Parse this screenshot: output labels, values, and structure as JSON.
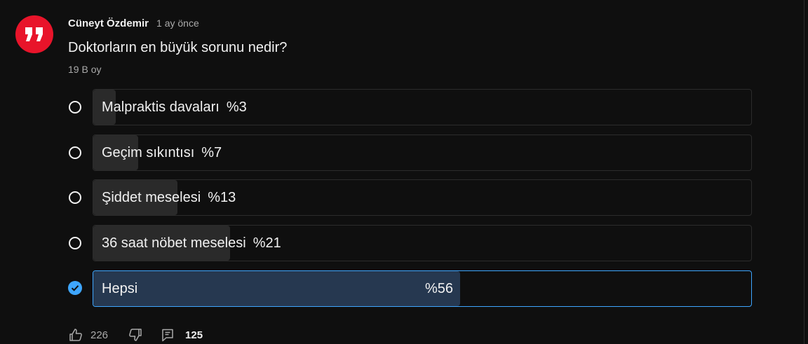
{
  "post": {
    "author": "Cüneyt Özdemir",
    "time": "1 ay önce",
    "question": "Doktorların en büyük sorunu nedir?",
    "votes": "19 B oy"
  },
  "poll": {
    "options": [
      {
        "label": "Malpraktis davaları",
        "percent_text": "%3",
        "percent": 3,
        "selected": false
      },
      {
        "label": "Geçim sıkıntısı",
        "percent_text": "%7",
        "percent": 7,
        "selected": false
      },
      {
        "label": "Şiddet meselesi",
        "percent_text": "%13",
        "percent": 13,
        "selected": false
      },
      {
        "label": "36 saat nöbet meselesi",
        "percent_text": "%21",
        "percent": 21,
        "selected": false
      },
      {
        "label": "Hepsi",
        "percent_text": "%56",
        "percent": 56,
        "selected": true
      }
    ]
  },
  "actions": {
    "likes": "226",
    "comments": "125"
  },
  "colors": {
    "background": "#0f0f0f",
    "avatar": "#e8142a",
    "accent": "#3ea6ff",
    "selected_fill": "#263850",
    "bar_fill": "#2a2a2a"
  },
  "icons": {
    "avatar": "quote-icon",
    "like": "thumbs-up-icon",
    "dislike": "thumbs-down-icon",
    "comment": "comment-icon",
    "selected": "check-circle-icon"
  }
}
